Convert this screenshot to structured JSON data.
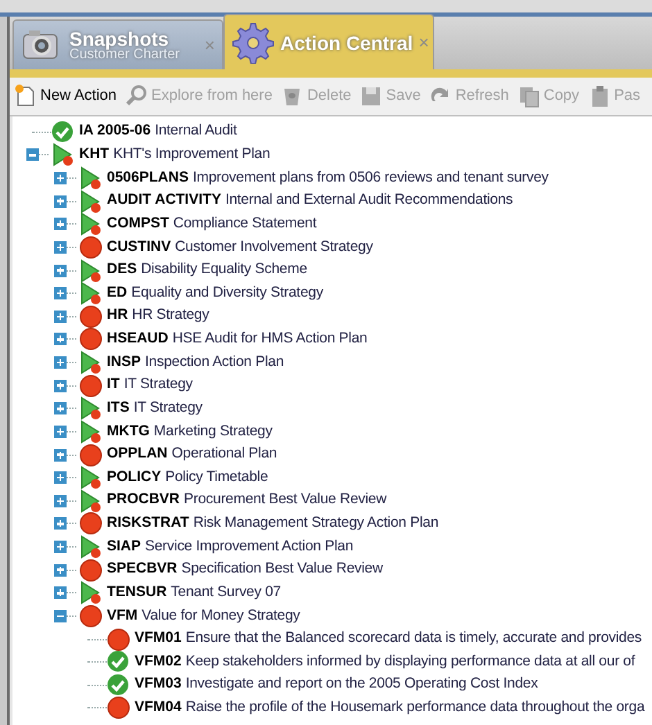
{
  "tabs": [
    {
      "title": "Snapshots",
      "subtitle": "Customer Charter",
      "selected": false,
      "close": "×"
    },
    {
      "title": "Action Central",
      "selected": true,
      "close": "×"
    }
  ],
  "toolbar": [
    {
      "label": "New Action",
      "disabled": false
    },
    {
      "label": "Explore from here",
      "disabled": true
    },
    {
      "label": "Delete",
      "disabled": true
    },
    {
      "label": "Save",
      "disabled": true
    },
    {
      "label": "Refresh",
      "disabled": true
    },
    {
      "label": "Copy",
      "disabled": true
    },
    {
      "label": "Pas",
      "disabled": true
    }
  ],
  "tree": [
    {
      "code": "IA 2005-06",
      "name": "Internal Audit",
      "kind": "done"
    },
    {
      "code": "KHT",
      "name": "KHT's Improvement Plan",
      "kind": "active",
      "expanded": true,
      "children": [
        {
          "code": "0506PLANS",
          "name": "Improvement plans from 0506 reviews and tenant survey",
          "kind": "active",
          "expanded": false
        },
        {
          "code": "AUDIT ACTIVITY",
          "name": "Internal and External Audit Recommendations",
          "kind": "active",
          "expanded": false
        },
        {
          "code": "COMPST",
          "name": "Compliance Statement",
          "kind": "active",
          "expanded": false
        },
        {
          "code": "CUSTINV",
          "name": "Customer Involvement Strategy",
          "kind": "overdue",
          "expanded": false
        },
        {
          "code": "DES",
          "name": "Disability Equality Scheme",
          "kind": "active",
          "expanded": false
        },
        {
          "code": "ED",
          "name": "Equality and Diversity Strategy",
          "kind": "active",
          "expanded": false
        },
        {
          "code": "HR",
          "name": "HR Strategy",
          "kind": "overdue",
          "expanded": false
        },
        {
          "code": "HSEAUD",
          "name": "HSE Audit for HMS Action Plan",
          "kind": "overdue",
          "expanded": false
        },
        {
          "code": "INSP",
          "name": "Inspection Action Plan",
          "kind": "active",
          "expanded": false
        },
        {
          "code": "IT",
          "name": "IT Strategy",
          "kind": "overdue",
          "expanded": false
        },
        {
          "code": "ITS",
          "name": "IT Strategy",
          "kind": "active",
          "expanded": false
        },
        {
          "code": "MKTG",
          "name": "Marketing Strategy",
          "kind": "active",
          "expanded": false
        },
        {
          "code": "OPPLAN",
          "name": "Operational Plan",
          "kind": "overdue",
          "expanded": false
        },
        {
          "code": "POLICY",
          "name": "Policy Timetable",
          "kind": "active",
          "expanded": false
        },
        {
          "code": "PROCBVR",
          "name": "Procurement Best Value Review",
          "kind": "active",
          "expanded": false
        },
        {
          "code": "RISKSTRAT",
          "name": "Risk Management Strategy Action Plan",
          "kind": "overdue",
          "expanded": false
        },
        {
          "code": "SIAP",
          "name": "Service Improvement Action Plan",
          "kind": "active",
          "expanded": false
        },
        {
          "code": "SPECBVR",
          "name": "Specification Best Value Review",
          "kind": "overdue",
          "expanded": false
        },
        {
          "code": "TENSUR",
          "name": "Tenant Survey 07",
          "kind": "active",
          "expanded": false
        },
        {
          "code": "VFM",
          "name": "Value for Money Strategy",
          "kind": "overdue",
          "expanded": true,
          "children": [
            {
              "code": "VFM01",
              "name": "Ensure that the Balanced scorecard data is timely, accurate and provides",
              "kind": "overdue"
            },
            {
              "code": "VFM02",
              "name": "Keep stakeholders informed by displaying performance data at all our of",
              "kind": "done"
            },
            {
              "code": "VFM03",
              "name": "Investigate and report on the 2005 Operating Cost Index",
              "kind": "done"
            },
            {
              "code": "VFM04",
              "name": "Raise the profile of the Housemark performance data throughout the orga",
              "kind": "overdue"
            }
          ]
        }
      ]
    }
  ]
}
